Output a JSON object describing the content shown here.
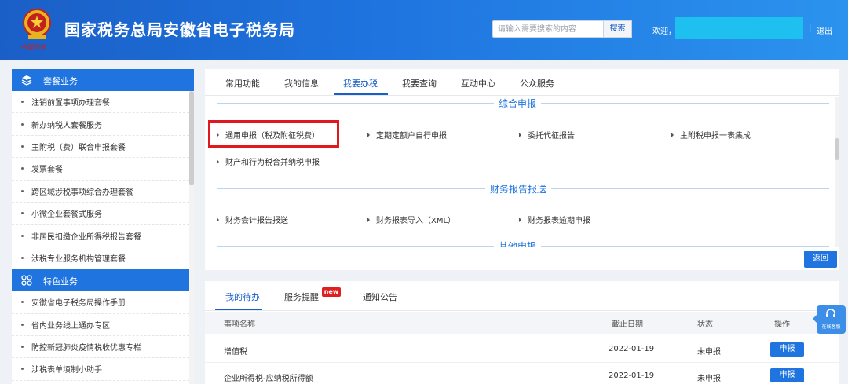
{
  "header": {
    "site_title": "国家税务总局安徽省电子税务局",
    "search_placeholder": "请输入需要搜索的内容",
    "search_button": "搜索",
    "welcome": "欢迎，",
    "separator": "|",
    "logout": "退出",
    "logo_lettering": "中国税务"
  },
  "sidebar": {
    "package_section": {
      "title": "套餐业务",
      "icon": "layers-icon",
      "items": [
        "注销前置事项办理套餐",
        "新办纳税人套餐服务",
        "主附税（费）联合申报套餐",
        "发票套餐",
        "跨区域涉税事项综合办理套餐",
        "小微企业套餐式服务",
        "非居民扣缴企业所得税报告套餐",
        "涉税专业服务机构管理套餐"
      ]
    },
    "featured_section": {
      "title": "特色业务",
      "icon": "grid-icon",
      "items": [
        "安徽省电子税务局操作手册",
        "省内业务线上通办专区",
        "防控新冠肺炎疫情税收优惠专栏",
        "涉税表单填制小助手"
      ]
    }
  },
  "main_tabs": [
    "常用功能",
    "我的信息",
    "我要办税",
    "我要查询",
    "互动中心",
    "公众服务"
  ],
  "sections": {
    "comprehensive": {
      "title": "综合申报",
      "items": [
        "通用申报（税及附征税费）",
        "定期定额户自行申报",
        "委托代征报告",
        "主附税申报一表集成",
        "财产和行为税合并纳税申报"
      ]
    },
    "financial": {
      "title": "财务报告报送",
      "items": [
        "财务会计报告报送",
        "财务报表导入（XML）",
        "财务报表逾期申报"
      ]
    },
    "other": {
      "title": "其他申报"
    }
  },
  "back_button": "返回",
  "todo": {
    "tabs": [
      "我的待办",
      "服务提醒",
      "通知公告"
    ],
    "badge": "new",
    "columns": {
      "name": "事项名称",
      "deadline": "截止日期",
      "status": "状态",
      "action": "操作"
    },
    "rows": [
      {
        "name": "增值税",
        "deadline": "2022-01-19",
        "status": "未申报",
        "action": "申报"
      },
      {
        "name": "企业所得税-应纳税所得额",
        "deadline": "2022-01-19",
        "status": "未申报",
        "action": "申报"
      }
    ]
  },
  "float_service": {
    "label": "在线客服",
    "icon": "headset-icon"
  },
  "colors": {
    "primary": "#1f74df",
    "highlight": "#e0191e",
    "user_mask": "#1ec0f0"
  }
}
